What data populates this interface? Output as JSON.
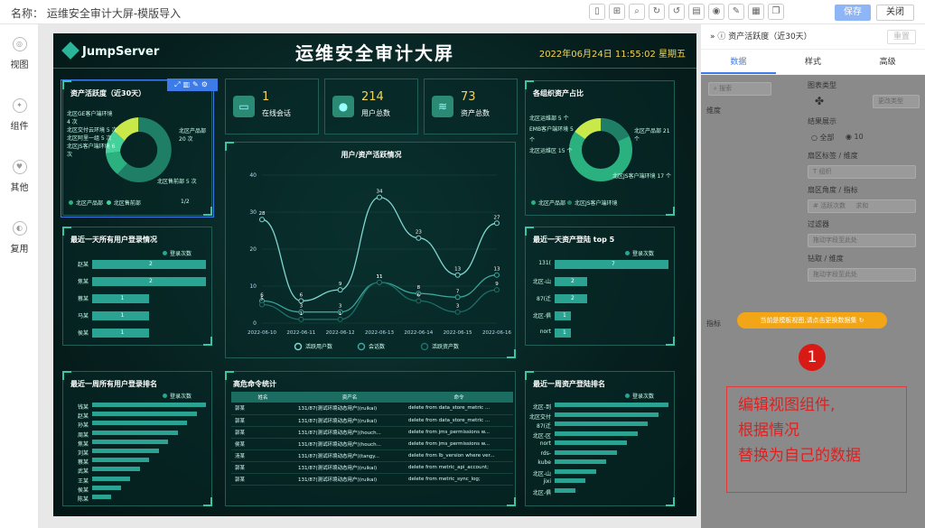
{
  "topbar": {
    "title": "名称： 运维安全审计大屏-模版导入",
    "save": "保存",
    "close": "关闭",
    "icons": [
      "phone-icon",
      "layout-icon",
      "zoom-icon",
      "refresh-icon",
      "undo-icon",
      "file-icon",
      "eye-icon",
      "brush-icon",
      "grid-icon",
      "copy-icon"
    ]
  },
  "leftnav": {
    "items": [
      {
        "label": "视图",
        "icon": "view-icon"
      },
      {
        "label": "组件",
        "icon": "component-icon"
      },
      {
        "label": "其他",
        "icon": "other-icon"
      },
      {
        "label": "复用",
        "icon": "reuse-icon"
      }
    ]
  },
  "screen": {
    "logo": "JumpServer",
    "title": "运维安全审计大屏",
    "datetime": "2022年06月24日 11:55:02 星期五",
    "stats": [
      {
        "value": "1",
        "label": "在线会话"
      },
      {
        "value": "214",
        "label": "用户总数"
      },
      {
        "value": "73",
        "label": "资产总数"
      }
    ],
    "asset_active": {
      "title": "资产活跃度（近30天）",
      "labels": [
        "北区GE客户端环境 4 次",
        "北区交付云环境 5 次",
        "北区阿里一组 5 次",
        "北区JS客户端环境 6 次",
        "北区产品部 20 次",
        "北区售前部 5 次"
      ],
      "legend": [
        "北区产品部",
        "北区售前部"
      ],
      "pager": "1/2"
    },
    "org_asset": {
      "title": "各组织资产占比",
      "labels": [
        "北区运维部 5 个",
        "EMB客户端环境 5 个",
        "北区运维区 15 个",
        "北区产品部 21 个",
        "北区JS客户端环境 17 个"
      ],
      "legend": [
        "北区产品部",
        "北区JS客户端环境"
      ]
    },
    "user_login_day": {
      "title": "最近一天所有用户登录情况",
      "legend": "登录次数",
      "rows": [
        {
          "name": "赵某",
          "value": "2"
        },
        {
          "name": "焦某",
          "value": "2"
        },
        {
          "name": "蔡某",
          "value": "1"
        },
        {
          "name": "马某",
          "value": "1"
        },
        {
          "name": "侯某",
          "value": "1"
        }
      ]
    },
    "asset_login_top5": {
      "title": "最近一天资产登陆 top 5",
      "legend": "登录次数",
      "rows": [
        {
          "name": "131(",
          "value": "7"
        },
        {
          "name": "北区-山",
          "value": "2"
        },
        {
          "name": "87(迁",
          "value": "2"
        },
        {
          "name": "北区-俱",
          "value": "1"
        },
        {
          "name": "nort",
          "value": "1"
        }
      ]
    },
    "user_login_week": {
      "title": "最近一周所有用户登录排名",
      "legend": "登录次数",
      "rows": [
        "钱某",
        "赵某",
        "孙某",
        "周某",
        "焦某",
        "刘某",
        "蔡某",
        "武某",
        "王某",
        "侯某",
        "陈某"
      ]
    },
    "asset_login_week": {
      "title": "最近一周资产登陆排名",
      "legend": "登录次数",
      "rows": [
        "北区-到",
        "北区交付",
        "87(迁",
        "北区-区",
        "nort",
        "rds-",
        "kube",
        "北区-山",
        "jixi",
        "北区-俱"
      ]
    },
    "cmd": {
      "title": "高危命令统计",
      "headers": [
        "姓名",
        "资产名",
        "命令"
      ],
      "rows": [
        [
          "郭某",
          "131/87(测试环境动态用户)(ruikai)",
          "delete from data_store_metric ..."
        ],
        [
          "郭某",
          "131/87(测试环境动态用户)(ruikai)",
          "delete from data_store_metric ..."
        ],
        [
          "郭某",
          "131/87(测试环境动态用户)(houch...",
          "delete from jms_permissions w..."
        ],
        [
          "侯某",
          "131/87(测试环境动态用户)(houch...",
          "delete from jms_permissions w..."
        ],
        [
          "汤某",
          "131/87(测试环境动态用户)(tangy...",
          "delete from lb_version where ver..."
        ],
        [
          "郭某",
          "131/87(测试环境动态用户)(ruikai)",
          "delete from metric_api_account;"
        ],
        [
          "郭某",
          "131/87(测试环境动态用户)(ruikai)",
          "delete from metric_sync_log;"
        ]
      ]
    }
  },
  "chart_data": {
    "type": "line",
    "title": "用户/资产活跃情况",
    "categories": [
      "2022-06-10",
      "2022-06-11",
      "2022-06-12",
      "2022-06-13",
      "2022-06-14",
      "2022-06-15",
      "2022-06-16"
    ],
    "ylim": [
      0,
      40
    ],
    "yticks": [
      "0",
      "10",
      "20",
      "30",
      "40"
    ],
    "series": [
      {
        "name": "活跃用户数",
        "values": [
          28,
          6,
          9,
          34,
          23,
          13,
          27
        ],
        "color": "#7fd6d0"
      },
      {
        "name": "会话数",
        "values": [
          6,
          3,
          3,
          11,
          8,
          7,
          13
        ],
        "color": "#3aa7a0"
      },
      {
        "name": "活跃资产数",
        "values": [
          5,
          1,
          1,
          11,
          6,
          3,
          9
        ],
        "color": "#1d6f68"
      }
    ]
  },
  "right": {
    "header": "资产活跃度（近30天）",
    "reset": "重置",
    "tabs": [
      "数据",
      "样式",
      "高级"
    ],
    "fields": {
      "search": "搜索",
      "dimension": "维度",
      "chart_type": "图表类型",
      "chart_type_btn": "更改类型",
      "result": "结果展示",
      "all": "全部",
      "count": "10",
      "sector_label": "扇区标签 / 维度",
      "sector_label_val": "组织",
      "sector_angle": "扇区角度 / 指标",
      "sector_angle_val": "# 活跃次数",
      "sum": "求和",
      "filter": "过滤器",
      "filter_ph": "拖动字段至此处",
      "drill": "钻取 / 维度",
      "drill_ph": "拖动字段至此处",
      "metric": "指标"
    },
    "pill": "当前是模板视图,请点击更换数据集",
    "badge": "1",
    "note": [
      "编辑视图组件,",
      "根据情况",
      "替换为自己的数据"
    ]
  }
}
